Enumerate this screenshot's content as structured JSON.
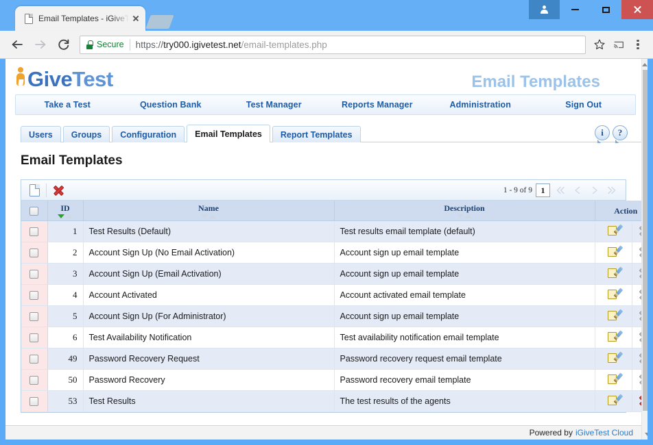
{
  "browser": {
    "tab_title": "Email Templates - iGiveTest",
    "url_scheme": "https://",
    "url_host": "try000.igivetest.net",
    "url_path": "/email-templates.php",
    "secure_label": "Secure",
    "new_tab_label": "New tab",
    "back_label": "Back",
    "forward_label": "Forward",
    "reload_label": "Reload",
    "bookmark_label": "Bookmark this page",
    "cast_label": "Cast",
    "menu_label": "Customize and control Google Chrome",
    "minimize_label": "Minimize",
    "maximize_label": "Maximize",
    "close_label": "Close",
    "profile_label": "Profile"
  },
  "site": {
    "logo_text_1": "Give",
    "logo_text_2": "Test",
    "page_header": "Email Templates",
    "nav": [
      {
        "label": "Take a Test"
      },
      {
        "label": "Question Bank"
      },
      {
        "label": "Test Manager"
      },
      {
        "label": "Reports Manager"
      },
      {
        "label": "Administration"
      },
      {
        "label": "Sign Out"
      }
    ],
    "subtabs": [
      {
        "label": "Users",
        "active": false
      },
      {
        "label": "Groups",
        "active": false
      },
      {
        "label": "Configuration",
        "active": false
      },
      {
        "label": "Email Templates",
        "active": true
      },
      {
        "label": "Report Templates",
        "active": false
      }
    ],
    "help_icons": {
      "info": "i",
      "help": "?"
    },
    "page_title": "Email Templates",
    "footer_text": "Powered by",
    "footer_link": "iGiveTest Cloud"
  },
  "grid": {
    "toolbar": {
      "new_label": "New",
      "delete_label": "Delete"
    },
    "pager": {
      "range": "1 - 9 of 9",
      "page": "1",
      "first_label": "First page",
      "prev_label": "Previous page",
      "next_label": "Next page",
      "last_label": "Last page"
    },
    "columns": [
      {
        "key": "check",
        "label": ""
      },
      {
        "key": "id",
        "label": "ID",
        "sort": "desc"
      },
      {
        "key": "name",
        "label": "Name",
        "sort": "none"
      },
      {
        "key": "description",
        "label": "Description",
        "sort": "none"
      },
      {
        "key": "action",
        "label": "Action",
        "sort": null
      }
    ],
    "rows": [
      {
        "id": "1",
        "name": "Test Results (Default)",
        "description": "Test results email template (default)",
        "delete_enabled": false
      },
      {
        "id": "2",
        "name": "Account Sign Up (No Email Activation)",
        "description": "Account sign up email template",
        "delete_enabled": false
      },
      {
        "id": "3",
        "name": "Account Sign Up (Email Activation)",
        "description": "Account sign up email template",
        "delete_enabled": false
      },
      {
        "id": "4",
        "name": "Account Activated",
        "description": "Account activated email template",
        "delete_enabled": false
      },
      {
        "id": "5",
        "name": "Account Sign Up (For Administrator)",
        "description": "Account sign up email template",
        "delete_enabled": false
      },
      {
        "id": "6",
        "name": "Test Availability Notification",
        "description": "Test availability notification email template",
        "delete_enabled": false
      },
      {
        "id": "49",
        "name": "Password Recovery Request",
        "description": "Password recovery request email template",
        "delete_enabled": false
      },
      {
        "id": "50",
        "name": "Password Recovery",
        "description": "Password recovery email template",
        "delete_enabled": false
      },
      {
        "id": "53",
        "name": "Test Results",
        "description": "The test results of the agents",
        "delete_enabled": true
      }
    ],
    "row_edit_label": "Edit",
    "row_delete_label": "Delete"
  },
  "colors": {
    "chrome_frame": "#64aff6",
    "brand_blue": "#3b73bd",
    "brand_light_blue": "#9cc2ea",
    "nav_link": "#1d5ba6",
    "header_row": "#cfdcef",
    "row_alt": "#e4eaf6",
    "check_col": "#fbe7e7",
    "delete_red": "#d23c3c",
    "close_red": "#cd5353",
    "secure_green": "#1a7f37"
  }
}
